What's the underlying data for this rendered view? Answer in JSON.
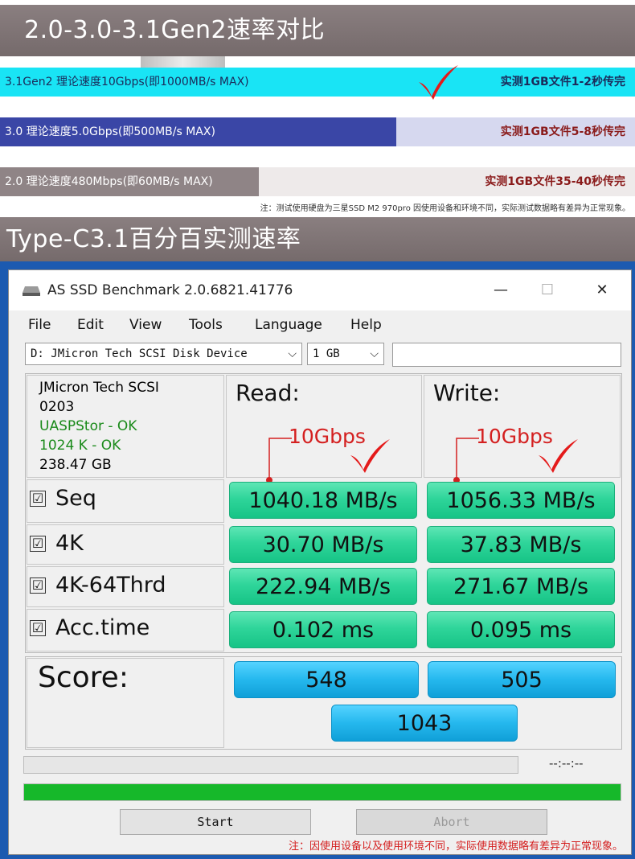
{
  "comparison": {
    "title": "2.0-3.0-3.1Gen2速率对比",
    "rows": [
      {
        "label": "3.1Gen2 理论速度10Gbps(即1000MB/s MAX)",
        "result": "实测1GB文件1-2秒传完",
        "fill_percent": 100,
        "fill_color": "#19e4f5",
        "rest_color": "#19e4f5",
        "label_color": "#1b2a5a",
        "result_color": "#1b2a5a"
      },
      {
        "label": "3.0 理论速度5.0Gbps(即500MB/s MAX)",
        "result": "实测1GB文件5-8秒传完",
        "fill_percent": 62.4,
        "fill_color": "#3a46a6",
        "rest_color": "#d6d8ef",
        "label_color": "#ffffff",
        "result_color": "#8a1a1a"
      },
      {
        "label": "2.0 理论速度480Mbps(即60MB/s MAX)",
        "result": "实测1GB文件35-40秒传完",
        "fill_percent": 40.8,
        "fill_color": "#8f8486",
        "rest_color": "#eeeaea",
        "label_color": "#ffffff",
        "result_color": "#8a1a1a"
      }
    ],
    "footnote": "注：测试使用硬盘为三星SSD M2 970pro 因使用设备和环境不同，实际测试数据略有差异为正常现象。"
  },
  "section2_title": "Type-C3.1百分百实测速率",
  "window": {
    "title": "AS SSD Benchmark 2.0.6821.41776",
    "controls": {
      "minimize": "—",
      "maximize": "☐",
      "close": "✕"
    },
    "menu": [
      "File",
      "Edit",
      "View",
      "Tools",
      "Language",
      "Help"
    ],
    "drive_select": "D: JMicron Tech SCSI Disk Device",
    "size_select": "1 GB",
    "drive_info": {
      "name": "JMicron Tech SCSI",
      "firmware": "0203",
      "driver": "UASPStor - OK",
      "alignment": "1024 K - OK",
      "capacity": "238.47 GB"
    },
    "read_label": "Read:",
    "write_label": "Write:",
    "annotation": "10Gbps",
    "rows": [
      {
        "label": "Seq",
        "read": "1040.18 MB/s",
        "write": "1056.33 MB/s"
      },
      {
        "label": "4K",
        "read": "30.70 MB/s",
        "write": "37.83 MB/s"
      },
      {
        "label": "4K-64Thrd",
        "read": "222.94 MB/s",
        "write": "271.67 MB/s"
      },
      {
        "label": "Acc.time",
        "read": "0.102 ms",
        "write": "0.095 ms"
      }
    ],
    "checkbox_mark": "☑",
    "score_label": "Score:",
    "score_read": "548",
    "score_write": "505",
    "score_total": "1043",
    "timer": "--:--:--",
    "progress_percent": 100,
    "start_label": "Start",
    "abort_label": "Abort",
    "footnote": "注：因使用设备以及使用环境不同，实际使用数据略有差异为正常现象。"
  }
}
